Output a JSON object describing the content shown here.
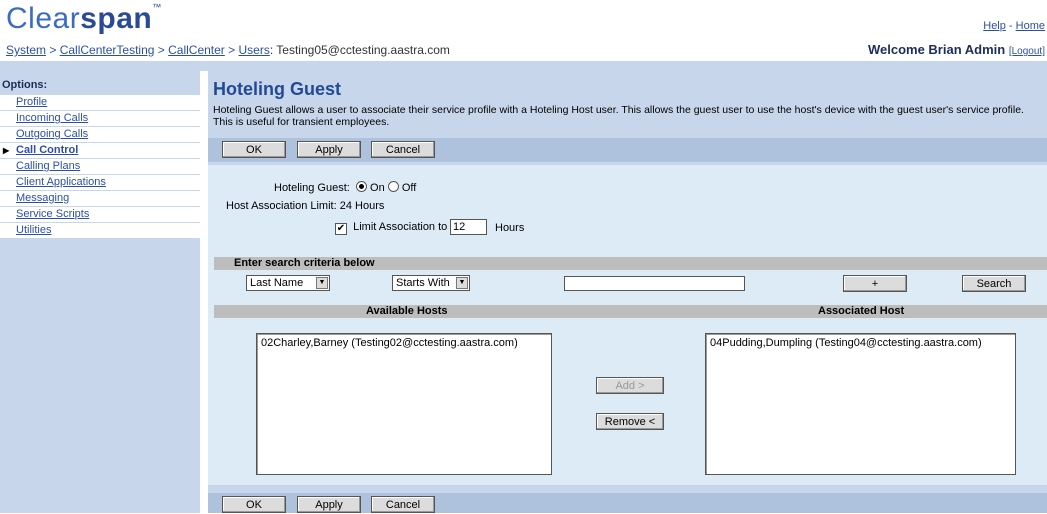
{
  "header": {
    "logo_part1": "Clear",
    "logo_part2": "span",
    "logo_tm": "™",
    "help": "Help",
    "home": "Home",
    "breadcrumb": [
      "System",
      "CallCenterTesting",
      "CallCenter",
      "Users"
    ],
    "breadcrumb_user": ": Testing05@cctesting.aastra.com",
    "welcome": "Welcome Brian Admin",
    "logout": "[Logout]"
  },
  "sidebar": {
    "title": "Options:",
    "items": [
      {
        "label": "Profile"
      },
      {
        "label": "Incoming Calls"
      },
      {
        "label": "Outgoing Calls"
      },
      {
        "label": "Call Control"
      },
      {
        "label": "Calling Plans"
      },
      {
        "label": "Client Applications"
      },
      {
        "label": "Messaging"
      },
      {
        "label": "Service Scripts"
      },
      {
        "label": "Utilities"
      }
    ]
  },
  "page": {
    "title": "Hoteling Guest",
    "desc1": "Hoteling Guest allows a user to associate their service profile with a Hoteling Host user. This allows the guest user to use the host's device with the guest user's service profile.",
    "desc2": "This is useful for transient employees."
  },
  "buttons": {
    "ok": "OK",
    "apply": "Apply",
    "cancel": "Cancel"
  },
  "form": {
    "guest_label": "Hoteling Guest:",
    "on": "On",
    "off": "Off",
    "limit_label": "Host Association Limit:",
    "limit_value": "24 Hours",
    "limit_assoc": "Limit Association to",
    "limit_hours_value": "12",
    "hours": "Hours"
  },
  "search": {
    "header": "Enter search criteria below",
    "field": "Last Name",
    "mode": "Starts With",
    "value": "",
    "plus": "+",
    "search": "Search"
  },
  "hosts": {
    "available_header": "Available Hosts",
    "associated_header": "Associated Host",
    "available": [
      "02Charley,Barney (Testing02@cctesting.aastra.com)"
    ],
    "associated": [
      "04Pudding,Dumpling (Testing04@cctesting.aastra.com)"
    ],
    "add": "Add >",
    "remove": "Remove <"
  }
}
